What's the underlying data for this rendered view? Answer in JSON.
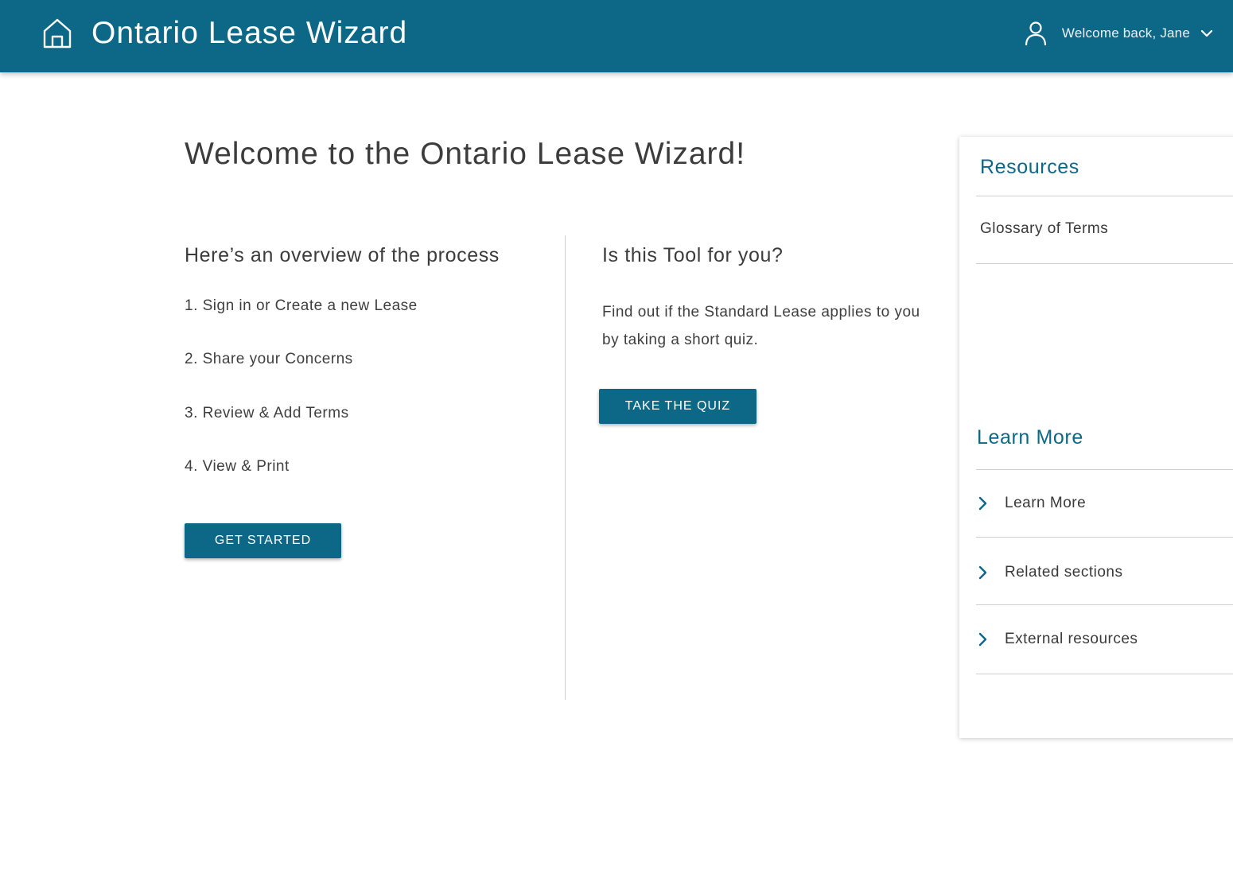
{
  "header": {
    "app_title": "Ontario Lease Wizard",
    "user_greeting": "Welcome back, Jane",
    "home_icon": "home-icon",
    "user_icon": "user-icon",
    "menu_icon": "chevron-down-icon"
  },
  "main": {
    "page_title": "Welcome to the Ontario Lease Wizard!",
    "overview": {
      "heading": "Here’s an overview of the process",
      "steps": [
        "1. Sign in or Create a new Lease",
        "2. Share your Concerns",
        "3. Review & Add Terms",
        "4. View & Print"
      ],
      "button_label": "GET STARTED"
    },
    "quiz": {
      "heading": "Is this Tool for you?",
      "description": "Find out if the Standard Lease applies to you by taking a short quiz.",
      "button_label": "TAKE THE QUIZ"
    }
  },
  "sidebar": {
    "resources": {
      "heading": "Resources",
      "links": [
        "Glossary of Terms"
      ]
    },
    "learn_more": {
      "heading": "Learn More",
      "items": [
        "Learn More",
        "Related sections",
        "External resources"
      ],
      "item_icon": "chevron-right-icon"
    }
  },
  "colors": {
    "primary": "#0d6887",
    "text": "#3c3c3c",
    "divider": "#cfcfcf"
  }
}
